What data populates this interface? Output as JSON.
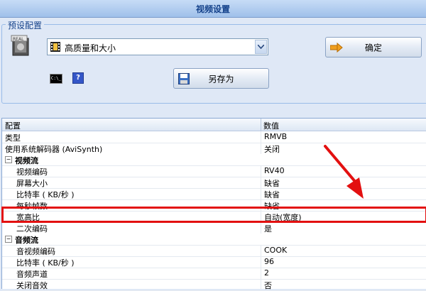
{
  "window": {
    "title": "视频设置"
  },
  "preset": {
    "legend": "预设配置",
    "selected": "高质量和大小",
    "ok_label": "确定",
    "save_as_label": "另存为",
    "real_icon_text": "REAL",
    "cmd_icon_text": "C:\\_"
  },
  "grid": {
    "headers": {
      "config": "配置",
      "value": "数值"
    },
    "rows": [
      {
        "key": "类型",
        "value": "RMVB"
      },
      {
        "key": "使用系统解码器 (AviSynth)",
        "value": "关闭"
      }
    ],
    "video": {
      "label": "视频流",
      "toggle": "⊟",
      "rows": [
        {
          "key": "视频编码",
          "value": "RV40"
        },
        {
          "key": "屏幕大小",
          "value": "缺省"
        },
        {
          "key": "比特率 ( KB/秒 )",
          "value": "缺省"
        },
        {
          "key": "每秒帧数",
          "value": "缺省"
        },
        {
          "key": "宽高比",
          "value": "自动(宽度)"
        },
        {
          "key": "二次编码",
          "value": "是"
        }
      ]
    },
    "audio": {
      "label": "音频流",
      "toggle": "⊟",
      "rows": [
        {
          "key": "音视频编码",
          "value": "COOK"
        },
        {
          "key": "比特率 ( KB/秒 )",
          "value": "96"
        },
        {
          "key": "音频声道",
          "value": "2"
        },
        {
          "key": "关闭音效",
          "value": "否"
        }
      ]
    }
  },
  "colors": {
    "highlight": "#e31010",
    "accent": "#15428b"
  }
}
